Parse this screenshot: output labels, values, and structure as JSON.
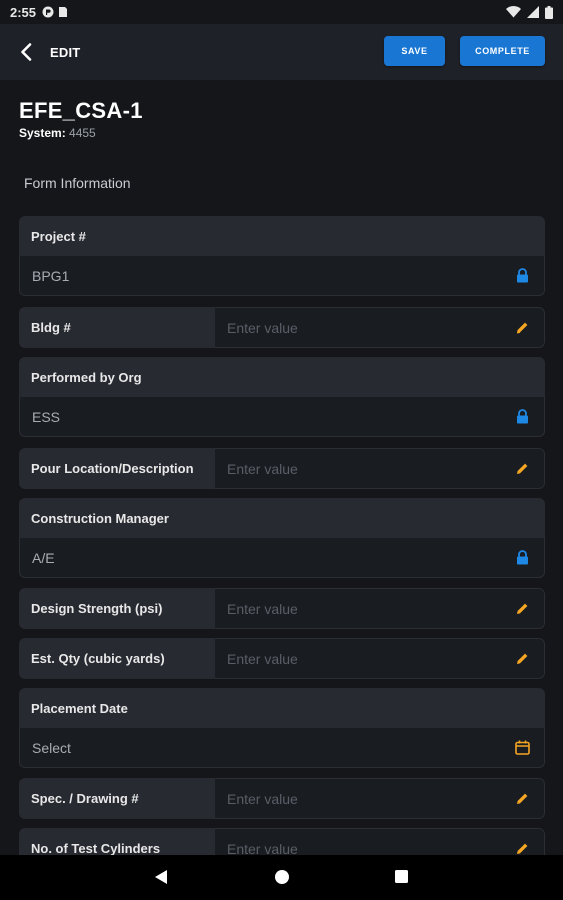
{
  "status_bar": {
    "time": "2:55"
  },
  "app_bar": {
    "title": "EDIT",
    "save_label": "SAVE",
    "complete_label": "COMPLETE"
  },
  "header": {
    "form_name": "EFE_CSA-1",
    "system_label": "System:",
    "system_value": "4455"
  },
  "section_label": "Form Information",
  "fields": [
    {
      "label": "Project #",
      "value": "BPG1",
      "icon": "lock-icon"
    },
    {
      "label": "Bldg #",
      "placeholder": "Enter value",
      "icon": "pencil-icon"
    },
    {
      "label": "Performed by Org",
      "value": "ESS",
      "icon": "lock-icon"
    },
    {
      "label": "Pour Location/Description",
      "placeholder": "Enter value",
      "icon": "pencil-icon"
    },
    {
      "label": "Construction Manager",
      "value": "A/E",
      "icon": "lock-icon"
    },
    {
      "label": "Design Strength (psi)",
      "placeholder": "Enter value",
      "icon": "pencil-icon"
    },
    {
      "label": "Est. Qty (cubic yards)",
      "placeholder": "Enter value",
      "icon": "pencil-icon"
    },
    {
      "label": "Placement Date",
      "value": "Select",
      "icon": "calendar-icon"
    },
    {
      "label": "Spec. / Drawing #",
      "placeholder": "Enter value",
      "icon": "pencil-icon"
    },
    {
      "label": "No. of Test Cylinders",
      "placeholder": "Enter value",
      "icon": "pencil-icon"
    }
  ],
  "colors": {
    "accent_blue": "#1976d2",
    "lock_blue": "#1e88e5",
    "edit_orange": "#f5a623",
    "background": "#14161a"
  }
}
